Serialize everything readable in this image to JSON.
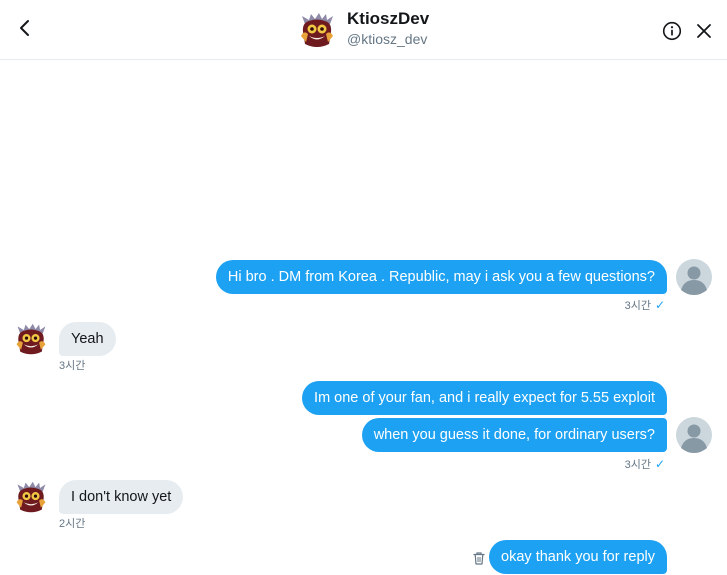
{
  "header": {
    "name": "KtioszDev",
    "handle": "@ktiosz_dev"
  },
  "messages": [
    {
      "text": "Hi bro . DM from Korea . Republic, may i ask you a few questions?",
      "time": "3시간",
      "check": "✓"
    },
    {
      "text": "Yeah",
      "time": "3시간"
    },
    {
      "text": "Im one of your fan, and i really expect for 5.55 exploit"
    },
    {
      "text": "when you guess it done, for ordinary users?",
      "time": "3시간",
      "check": "✓"
    },
    {
      "text": "I don't know yet",
      "time": "2시간"
    },
    {
      "text": "okay thank you for reply"
    }
  ],
  "colors": {
    "outgoing_bubble": "#1da1f2",
    "incoming_bubble": "#e6ecf0",
    "meta_text": "#657786"
  },
  "icons": {
    "back": "chevron-left-icon",
    "info": "info-icon",
    "close": "close-icon",
    "delete": "trash-icon"
  }
}
